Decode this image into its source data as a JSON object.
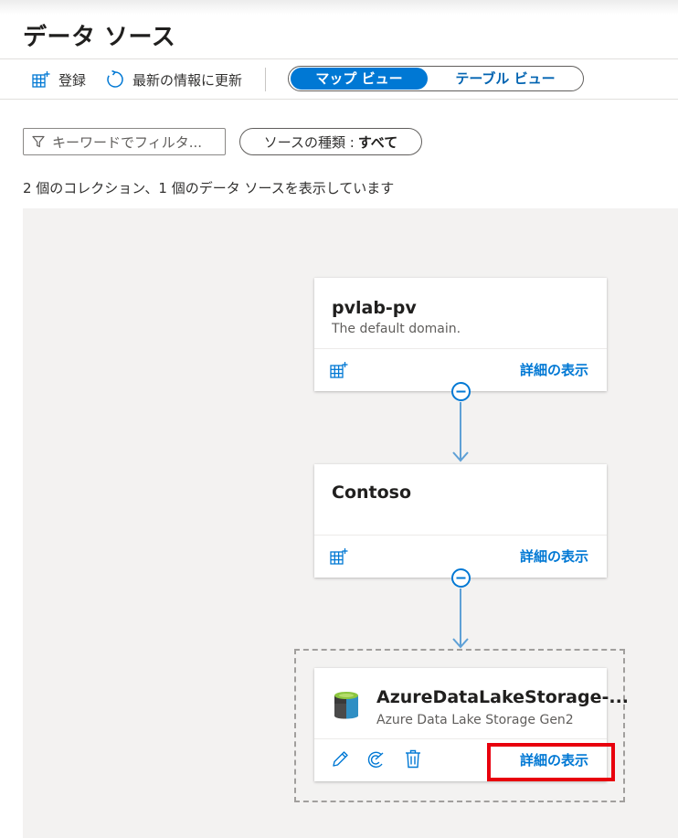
{
  "page": {
    "title": "データ ソース"
  },
  "toolbar": {
    "register_label": "登録",
    "refresh_label": "最新の情報に更新",
    "map_view_label": "マップ ビュー",
    "table_view_label": "テーブル ビュー"
  },
  "filter": {
    "keyword_placeholder": "キーワードでフィルタ...",
    "source_type_label": "ソースの種類 :",
    "source_type_value": "すべて"
  },
  "summary_text": "2 個のコレクション、1 個のデータ ソースを表示しています",
  "map": {
    "collections": [
      {
        "title": "pvlab-pv",
        "subtitle": "The default domain.",
        "details_label": "詳細の表示"
      },
      {
        "title": "Contoso",
        "subtitle": "",
        "details_label": "詳細の表示"
      }
    ],
    "data_source": {
      "title": "AzureDataLakeStorage-...",
      "subtitle": "Azure Data Lake Storage Gen2",
      "details_label": "詳細の表示"
    }
  },
  "colors": {
    "accent": "#0078d4",
    "connector": "#5ea0d6",
    "highlight": "#e8000d"
  }
}
